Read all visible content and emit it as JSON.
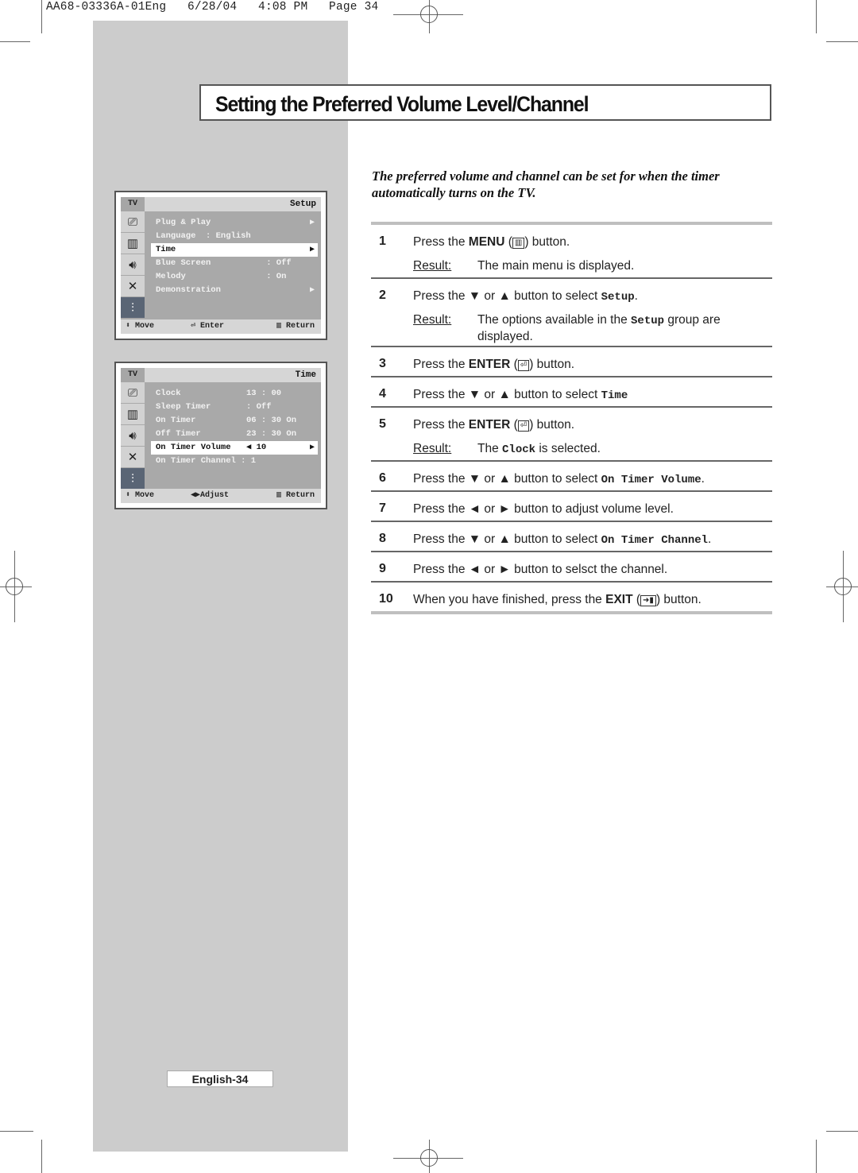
{
  "print_header": "AA68-03336A-01Eng   6/28/04   4:08 PM   Page 34",
  "title": "Setting the Preferred Volume Level/Channel",
  "intro": "The preferred volume and channel can be set for when the timer automatically turns on the TV.",
  "osd_setup": {
    "tv_label": "TV",
    "menu_title": "Setup",
    "side_icons": [
      "input-icon",
      "picture-icon",
      "sound-icon",
      "channel-icon",
      "setup-icon"
    ],
    "rows": [
      {
        "label": "Plug & Play",
        "value": "",
        "arrow": "▶",
        "selected": false
      },
      {
        "label": "Language  : English",
        "value": "",
        "arrow": "",
        "selected": false
      },
      {
        "label": "Time",
        "value": "",
        "arrow": "▶",
        "selected": true
      },
      {
        "label": "Blue Screen",
        "value": "    : Off",
        "arrow": "",
        "selected": false
      },
      {
        "label": "Melody",
        "value": "    : On",
        "arrow": "",
        "selected": false
      },
      {
        "label": "Demonstration",
        "value": "",
        "arrow": "▶",
        "selected": false
      }
    ],
    "footer": {
      "move": "Move",
      "action": "Enter",
      "return": "Return"
    }
  },
  "osd_time": {
    "tv_label": "TV",
    "menu_title": "Time",
    "side_icons": [
      "input-icon",
      "picture-icon",
      "sound-icon",
      "channel-icon",
      "setup-icon"
    ],
    "rows": [
      {
        "label": "Clock",
        "value": "13 : 00",
        "arrow": "",
        "selected": false
      },
      {
        "label": "Sleep Timer",
        "value": ": Off",
        "arrow": "",
        "selected": false
      },
      {
        "label": "On Timer",
        "value": "06 : 30 On",
        "arrow": "",
        "selected": false
      },
      {
        "label": "Off Timer",
        "value": "23 : 30 On",
        "arrow": "",
        "selected": false
      },
      {
        "label": "On Timer Volume",
        "value": "◀ 10",
        "arrow": "▶",
        "selected": true
      },
      {
        "label": "On Timer Channel : 1",
        "value": "",
        "arrow": "",
        "selected": false
      }
    ],
    "footer": {
      "move": "Move",
      "action": "Adjust",
      "return": "Return"
    }
  },
  "steps": [
    {
      "num": "1",
      "text_parts": [
        "Press the ",
        "MENU",
        " (",
        ") button."
      ],
      "icon": "menu-icon",
      "result": "The main menu is displayed."
    },
    {
      "num": "2",
      "pre": "Press the ▼ or ▲ button to select ",
      "code": "Setup",
      "post": ".",
      "result_pre": "The options available in the ",
      "result_code": "Setup",
      "result_post": " group are displayed."
    },
    {
      "num": "3",
      "text_parts": [
        "Press the ",
        "ENTER",
        " (",
        ") button."
      ],
      "icon": "enter-icon"
    },
    {
      "num": "4",
      "pre": "Press the ▼ or ▲ button to select ",
      "code": "Time",
      "post": ""
    },
    {
      "num": "5",
      "text_parts": [
        "Press the ",
        "ENTER",
        " (",
        ") button."
      ],
      "icon": "enter-icon",
      "result_pre": "The ",
      "result_code": "Clock",
      "result_post": " is selected."
    },
    {
      "num": "6",
      "pre": "Press the ▼ or ▲ button to select ",
      "code": "On Timer Volume",
      "post": "."
    },
    {
      "num": "7",
      "text": "Press the ◄ or ► button to adjust volume level."
    },
    {
      "num": "8",
      "pre": "Press the ▼ or ▲ button to select ",
      "code": "On Timer Channel",
      "post": "."
    },
    {
      "num": "9",
      "text": "Press the ◄ or ► button to selsct the channel."
    },
    {
      "num": "10",
      "text_parts": [
        "When you have finished, press the ",
        "EXIT",
        " (",
        ") button."
      ],
      "icon": "exit-icon"
    }
  ],
  "result_label": "Result:",
  "page_footer": "English-34"
}
